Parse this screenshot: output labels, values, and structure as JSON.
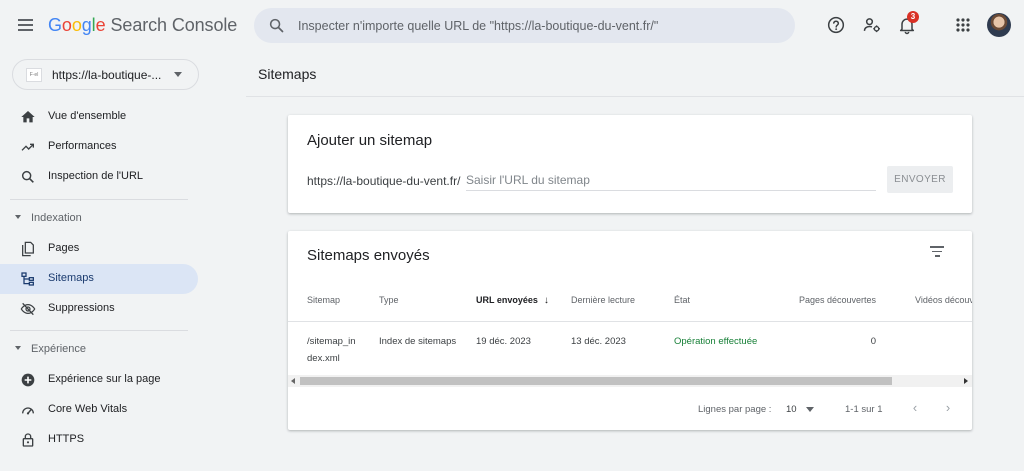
{
  "header": {
    "brand": {
      "g1": "G",
      "g2": "o",
      "g3": "o",
      "g4": "g",
      "g5": "l",
      "g6": "e",
      "product": "Search Console"
    },
    "search_placeholder": "Inspecter n'importe quelle URL de \"https://la-boutique-du-vent.fr/\"",
    "notification_count": "3",
    "icons": [
      "menu-icon",
      "search-icon",
      "help-icon",
      "manage-users-icon",
      "bell-icon",
      "apps-grid-icon"
    ]
  },
  "sidebar": {
    "property": {
      "label": "https://la-boutique-...",
      "favicon_text": "F·el"
    },
    "items": [
      {
        "label": "Vue d'ensemble",
        "icon": "home-icon"
      },
      {
        "label": "Performances",
        "icon": "trending-up-icon"
      },
      {
        "label": "Inspection de l'URL",
        "icon": "search-icon"
      }
    ],
    "sections": [
      {
        "label": "Indexation",
        "items": [
          {
            "label": "Pages",
            "icon": "pages-icon"
          },
          {
            "label": "Sitemaps",
            "icon": "sitemap-icon",
            "active": true
          },
          {
            "label": "Suppressions",
            "icon": "visibility-off-icon"
          }
        ]
      },
      {
        "label": "Expérience",
        "items": [
          {
            "label": "Expérience sur la page",
            "icon": "add-circle-icon"
          },
          {
            "label": "Core Web Vitals",
            "icon": "speed-gauge-icon"
          },
          {
            "label": "HTTPS",
            "icon": "lock-icon"
          }
        ]
      }
    ]
  },
  "main": {
    "page_title": "Sitemaps",
    "add_card": {
      "title": "Ajouter un sitemap",
      "prefix": "https://la-boutique-du-vent.fr/",
      "input_placeholder": "Saisir l'URL du sitemap",
      "submit_label": "ENVOYER"
    },
    "submitted_card": {
      "title": "Sitemaps envoyés",
      "columns": [
        "Sitemap",
        "Type",
        "URL envoyées",
        "Dernière lecture",
        "État",
        "Pages découvertes",
        "Vidéos découv"
      ],
      "sorted_column": "URL envoyées",
      "rows": [
        {
          "sitemap": "/sitemap_index.xml",
          "sitemap_line1": "/sitemap_in",
          "sitemap_line2": "dex.xml",
          "type": "Index de sitemaps",
          "submitted": "19 déc. 2023",
          "last_read": "13 déc. 2023",
          "status": "Opération effectuée",
          "pages_discovered": "0",
          "videos_discovered": ""
        }
      ],
      "pagination": {
        "rows_per_page_label": "Lignes par page :",
        "rows_per_page": "10",
        "range": "1-1 sur 1"
      }
    }
  },
  "colors": {
    "accent": "#1a73e8",
    "active_nav_bg": "#dbe5f5",
    "success": "#188038",
    "badge": "#d93025",
    "background": "#f1f3f4"
  }
}
